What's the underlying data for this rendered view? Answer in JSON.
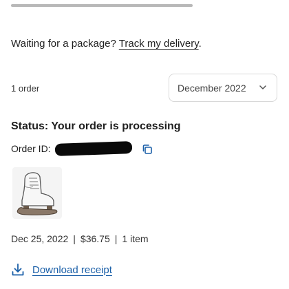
{
  "banner": {
    "waiting_text": "Waiting for a package? ",
    "track_link": "Track my delivery",
    "period": "."
  },
  "filters": {
    "order_count": "1 order",
    "month_selected": "December 2022"
  },
  "order": {
    "status": "Status: Your order is processing",
    "order_id_label": "Order ID:",
    "date": "Dec 25, 2022",
    "total": "$36.75",
    "item_count": "1 item",
    "separator": "|",
    "product_icon": "ice-skate-icon"
  },
  "actions": {
    "download_receipt": "Download receipt"
  },
  "colors": {
    "link": "#1a5fa8",
    "text": "#1f1f1f"
  }
}
